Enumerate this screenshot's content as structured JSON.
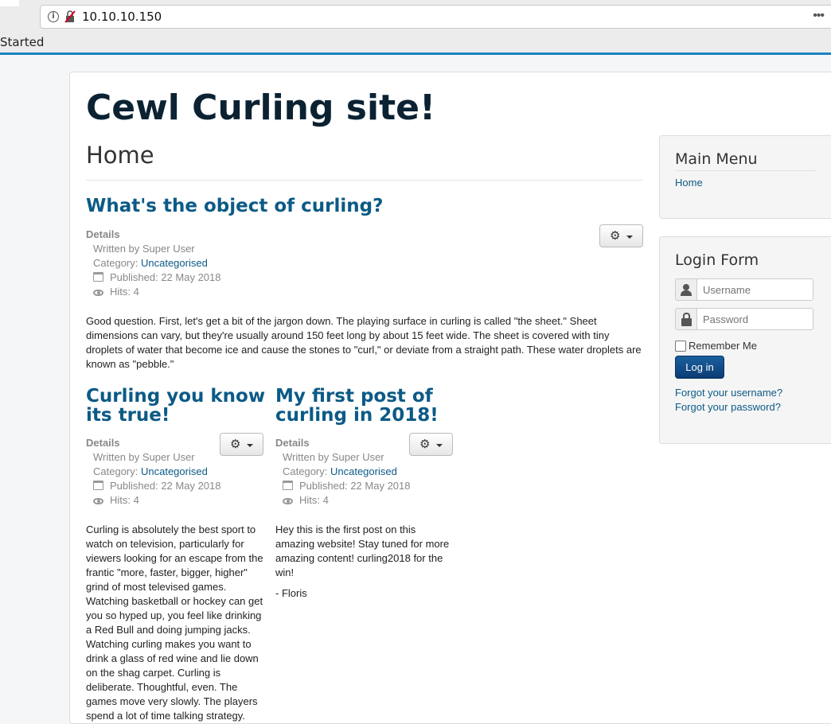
{
  "browser": {
    "url": "10.10.10.150",
    "bookmark_label": "Started",
    "more_label": "•••"
  },
  "site": {
    "title": "Cewl Curling site!",
    "page_heading": "Home"
  },
  "articles": [
    {
      "title": "What's the object of curling?",
      "details_label": "Details",
      "author": "Written by Super User",
      "category_label": "Category: ",
      "category": "Uncategorised",
      "published": "Published: 22 May 2018",
      "hits": "Hits: 4",
      "body": "Good question. First, let's get a bit of the jargon down. The playing surface in curling is called \"the sheet.\" Sheet dimensions can vary, but they're usually around 150 feet long by about 15 feet wide. The sheet is covered with tiny droplets of water that become ice and cause the stones to \"curl,\" or deviate from a straight path. These water droplets are known as \"pebble.\""
    },
    {
      "title": "Curling you know its true!",
      "details_label": "Details",
      "author": "Written by Super User",
      "category_label": "Category: ",
      "category": "Uncategorised",
      "published": "Published: 22 May 2018",
      "hits": "Hits: 4",
      "body": "Curling is absolutely the best sport to watch on television, particularly for viewers looking for an escape from the frantic \"more, faster, bigger, higher\" grind of most televised games. Watching basketball or hockey can get you so hyped up, you feel like drinking a Red Bull and doing jumping jacks. Watching curling makes you want to drink a glass of red wine and lie down on the shag carpet. Curling is deliberate. Thoughtful, even. The games move very slowly. The players spend a lot of time talking strategy."
    },
    {
      "title": "My first post of curling in 2018!",
      "details_label": "Details",
      "author": "Written by Super User",
      "category_label": "Category: ",
      "category": "Uncategorised",
      "published": "Published: 22 May 2018",
      "hits": "Hits: 4",
      "body": "Hey this is the first post on this amazing website! Stay tuned for more amazing content! curling2018 for the win!",
      "signature": "- Floris"
    }
  ],
  "sidebar": {
    "main_menu": {
      "title": "Main Menu",
      "items": [
        "Home"
      ]
    },
    "login_form": {
      "title": "Login Form",
      "username_placeholder": "Username",
      "password_placeholder": "Password",
      "remember_label": "Remember Me",
      "login_button": "Log in",
      "forgot_username": "Forgot your username?",
      "forgot_password": "Forgot your password?"
    }
  },
  "icons": {
    "gear": "⚙",
    "info": "i"
  },
  "colors": {
    "link": "#0c5a86",
    "title": "#0b2233",
    "accent": "#1b82c4",
    "primary_button": "#0c3c74"
  }
}
